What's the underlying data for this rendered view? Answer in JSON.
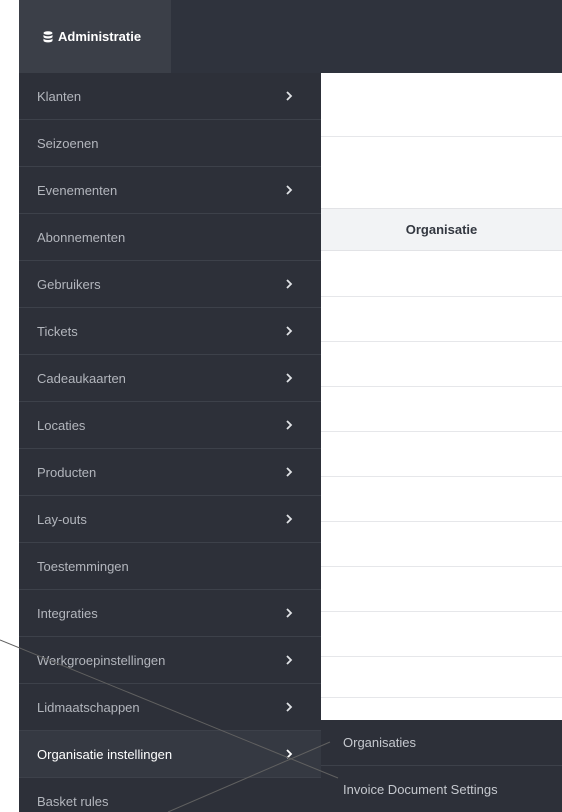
{
  "header": {
    "admin_tab_label": "Administratie",
    "admin_icon": "database-icon"
  },
  "sidebar": {
    "items": [
      {
        "label": "Klanten",
        "has_submenu": true
      },
      {
        "label": "Seizoenen",
        "has_submenu": false
      },
      {
        "label": "Evenementen",
        "has_submenu": true
      },
      {
        "label": "Abonnementen",
        "has_submenu": false
      },
      {
        "label": "Gebruikers",
        "has_submenu": true
      },
      {
        "label": "Tickets",
        "has_submenu": true
      },
      {
        "label": "Cadeaukaarten",
        "has_submenu": true
      },
      {
        "label": "Locaties",
        "has_submenu": true
      },
      {
        "label": "Producten",
        "has_submenu": true
      },
      {
        "label": "Lay-outs",
        "has_submenu": true
      },
      {
        "label": "Toestemmingen",
        "has_submenu": false
      },
      {
        "label": "Integraties",
        "has_submenu": true
      },
      {
        "label": "Werkgroepinstellingen",
        "has_submenu": true
      },
      {
        "label": "Lidmaatschappen",
        "has_submenu": true
      },
      {
        "label": "Organisatie instellingen",
        "has_submenu": true,
        "active": true
      },
      {
        "label": "Basket rules",
        "has_submenu": false
      }
    ]
  },
  "table": {
    "column_header": "Organisatie"
  },
  "submenu": {
    "items": [
      {
        "label": "Organisaties"
      },
      {
        "label": "Invoice Document Settings"
      }
    ]
  },
  "colors": {
    "topbar": "#2f333d",
    "sidebar": "#2d3039",
    "active_item": "#353942",
    "text_muted": "#b3b6bd"
  }
}
